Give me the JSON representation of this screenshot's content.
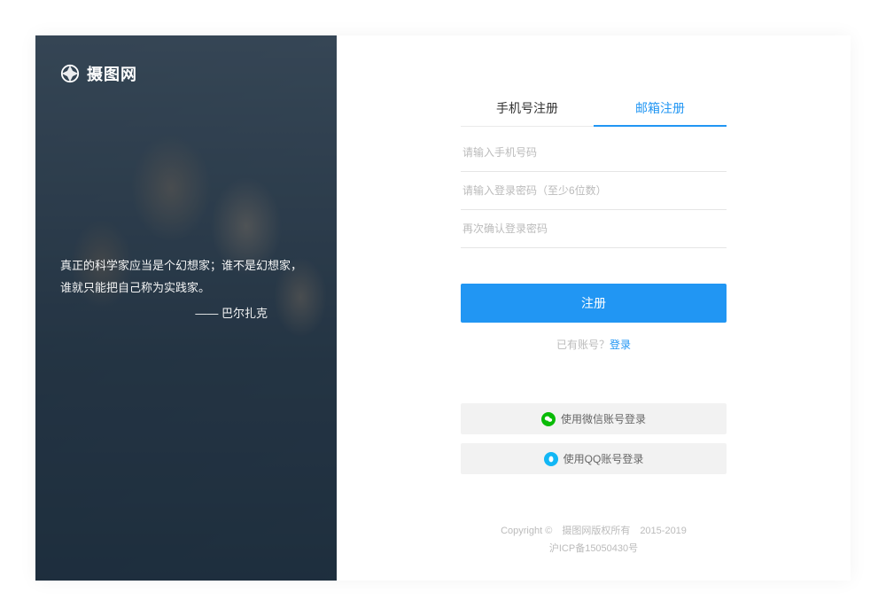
{
  "left": {
    "site_name": "摄图网",
    "quote": "真正的科学家应当是个幻想家；谁不是幻想家，谁就只能把自己称为实践家。",
    "author": "—— 巴尔扎克"
  },
  "tabs": {
    "phone": "手机号注册",
    "email": "邮箱注册"
  },
  "form": {
    "phone_placeholder": "请输入手机号码",
    "password_placeholder": "请输入登录密码（至少6位数）",
    "confirm_placeholder": "再次确认登录密码",
    "register_btn": "注册"
  },
  "login_hint": {
    "prefix": "已有账号？",
    "link": "登录"
  },
  "social": {
    "wechat": "使用微信账号登录",
    "qq": "使用QQ账号登录"
  },
  "footer": {
    "line1": "Copyright ©　摄图网版权所有　2015-2019",
    "line2": "沪ICP备15050430号"
  },
  "colors": {
    "accent": "#2196f3",
    "wechat": "#09bb07",
    "qq": "#12b7f5"
  }
}
